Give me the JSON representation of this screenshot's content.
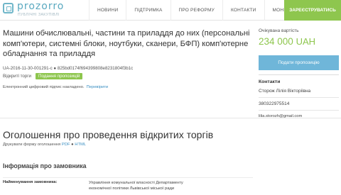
{
  "logo": {
    "name": "prozorro",
    "subtitle": "ПУБЛІЧНІ ЗАКУПІВЛІ"
  },
  "nav": {
    "items": [
      {
        "label": "НОВИНИ"
      },
      {
        "label": "ПІДТРИМКА"
      },
      {
        "label": "ПРО РЕФОРМУ"
      },
      {
        "label": "КОНТАКТИ"
      },
      {
        "label": "МОНІТОРИНГ"
      }
    ],
    "register": "ЗАРЕЄСТРУВАТИСЬ"
  },
  "tender": {
    "title": "Машини обчислювальні, частини та приладдя до них (персональні комп'ютери, системні блоки, ноутбуки, сканери, БФП) комп'ютерне обладнання та приладдя",
    "id_text": "UA-2016-11-30-001291-c ● 825bd0174f694399808e8231804f3b1c",
    "status_label": "Відкриті торги",
    "status_badge": "Подання пропозицій",
    "signature_text": "Електронний цифровий підпис накладено.",
    "signature_link": "Перевірити"
  },
  "sidebar": {
    "expected_label": "Очікувана вартість",
    "expected_amount": "234 000",
    "expected_currency": "UAH",
    "offer_button": "Подати пропозицію",
    "contacts_title": "Контакти",
    "contact_name": "Сторож Лілія Вікторіівна",
    "contact_phone": "380322975514",
    "contact_email": "lilia.storozh@gmail.com"
  },
  "announcement": {
    "title": "Оголошення про проведення відкритих торгів",
    "print_text": "Друкувати форму оголошення",
    "pdf": "PDF",
    "html": "HTML",
    "customer_title": "Інформація про замовника",
    "name_label": "Найменування замовника:",
    "name_value": "Управління комунальної власності Департаменту економічної політики Львівської міської ради"
  },
  "colors": {
    "accent_green": "#8ec64e",
    "accent_blue": "#6fb6d9",
    "link_blue": "#3a8fc2",
    "logo_blue": "#5aa9c0"
  }
}
